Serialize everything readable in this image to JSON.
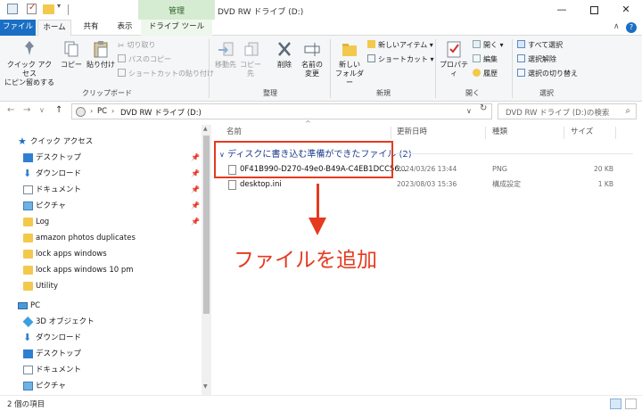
{
  "titlebar": {
    "context_tab_group": "管理",
    "title": "DVD RW ドライブ (D:)",
    "quick_access_dropdown": "▾",
    "minimize": "—",
    "close": "✕"
  },
  "tabs": {
    "file": "ファイル",
    "home": "ホーム",
    "share": "共有",
    "view": "表示",
    "drive_tools": "ドライブ ツール"
  },
  "ribbon": {
    "clipboard": {
      "pin_quick_access": "クイック アクセス\nにピン留めする",
      "copy": "コピー",
      "paste": "貼り付け",
      "cut": "切り取り",
      "copy_path": "パスのコピー",
      "paste_shortcut": "ショートカットの貼り付け",
      "group_label": "クリップボード"
    },
    "organize": {
      "move_to": "移動先",
      "copy_to": "コピー先",
      "delete": "削除",
      "rename": "名前の\n変更",
      "group_label": "整理"
    },
    "new": {
      "new_folder": "新しい\nフォルダー",
      "new_item": "新しいアイテム ▾",
      "shortcut": "ショートカット ▾",
      "group_label": "新規"
    },
    "open": {
      "properties": "プロパティ",
      "open": "開く ▾",
      "edit": "編集",
      "history": "履歴",
      "group_label": "開く"
    },
    "select": {
      "select_all": "すべて選択",
      "select_none": "選択解除",
      "invert_selection": "選択の切り替え",
      "group_label": "選択"
    }
  },
  "address": {
    "back": "←",
    "forward": "→",
    "recent": "∨",
    "up": "↑",
    "sep": "›",
    "path": [
      "PC",
      "DVD RW ドライブ (D:)"
    ],
    "dropdown": "∨",
    "refresh": "↻",
    "search_placeholder": "DVD RW ドライブ (D:)の検索",
    "search_icon": "search-icon"
  },
  "navpane": {
    "items": [
      {
        "label": "クイック アクセス",
        "icon": "star-icon",
        "pinned": false
      },
      {
        "label": "デスクトップ",
        "icon": "desktop-icon",
        "pinned": true
      },
      {
        "label": "ダウンロード",
        "icon": "download-icon",
        "pinned": true
      },
      {
        "label": "ドキュメント",
        "icon": "document-icon",
        "pinned": true
      },
      {
        "label": "ピクチャ",
        "icon": "pictures-icon",
        "pinned": true
      },
      {
        "label": "Log",
        "icon": "folder-icon",
        "pinned": true
      },
      {
        "label": "amazon photos duplicates",
        "icon": "folder-icon",
        "pinned": false
      },
      {
        "label": "lock apps windows",
        "icon": "folder-icon",
        "pinned": false
      },
      {
        "label": "lock apps windows 10 pm",
        "icon": "folder-icon",
        "pinned": false
      },
      {
        "label": "Utility",
        "icon": "folder-icon",
        "pinned": false
      },
      {
        "label": "PC",
        "icon": "pc-icon",
        "pinned": false
      },
      {
        "label": "3D オブジェクト",
        "icon": "3d-objects-icon",
        "pinned": false
      },
      {
        "label": "ダウンロード",
        "icon": "download-icon",
        "pinned": false
      },
      {
        "label": "デスクトップ",
        "icon": "desktop-icon",
        "pinned": false
      },
      {
        "label": "ドキュメント",
        "icon": "document-icon",
        "pinned": false
      },
      {
        "label": "ピクチャ",
        "icon": "pictures-icon",
        "pinned": false
      }
    ],
    "pin_glyph": "📌"
  },
  "filelist": {
    "columns": {
      "name": "名前",
      "date": "更新日時",
      "type": "種類",
      "size": "サイズ"
    },
    "sort_caret": "^",
    "group_header": "ディスクに書き込む準備ができたファイル (2)",
    "files": [
      {
        "name": "0F41B990-D270-49e0-B49A-C4EB1DCC56...",
        "date": "2024/03/26 13:44",
        "type": "PNG",
        "size": "20 KB"
      },
      {
        "name": "desktop.ini",
        "date": "2023/08/03 15:36",
        "type": "構成設定",
        "size": "1 KB"
      }
    ]
  },
  "annotation": {
    "text": "ファイルを追加",
    "color": "#e53a1f"
  },
  "status": {
    "item_count": "2 個の項目"
  },
  "colors": {
    "accent": "#1a6fc4",
    "context_tab": "#d6ecd2",
    "annotation": "#e53a1f"
  }
}
